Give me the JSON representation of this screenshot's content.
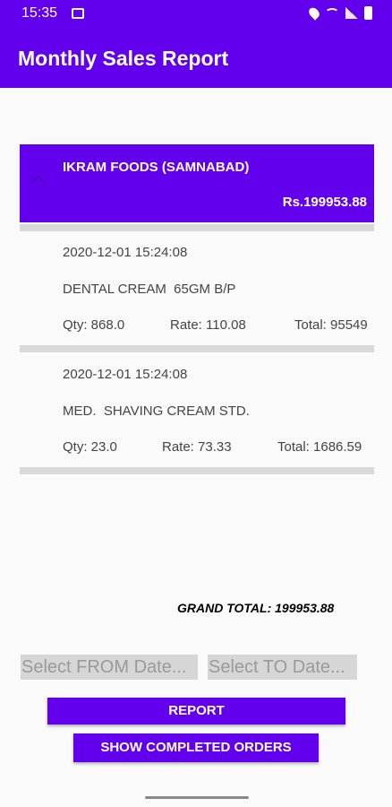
{
  "status_bar": {
    "time": "15:35"
  },
  "app_bar": {
    "title": "Monthly Sales Report"
  },
  "group": {
    "title": "IKRAM FOODS (SAMNABAD)",
    "amount": "Rs.199953.88",
    "items": [
      {
        "date": "2020-12-01 15:24:08",
        "name": "DENTAL CREAM  65GM B/P",
        "qty": "Qty: 868.0",
        "rate": "Rate: 110.08",
        "total": "Total: 95549"
      },
      {
        "date": "2020-12-01 15:24:08",
        "name": "MED.  SHAVING CREAM STD.",
        "qty": "Qty: 23.0",
        "rate": "Rate: 73.33",
        "total": "Total: 1686.59"
      }
    ]
  },
  "grand_total": "GRAND TOTAL: 199953.88",
  "from_date": {
    "placeholder": "Select FROM Date..."
  },
  "to_date": {
    "placeholder": "Select TO Date..."
  },
  "buttons": {
    "report": "REPORT",
    "completed": "SHOW COMPLETED ORDERS"
  },
  "colors": {
    "primary": "#6200ee",
    "divider": "#d9d9d9"
  }
}
